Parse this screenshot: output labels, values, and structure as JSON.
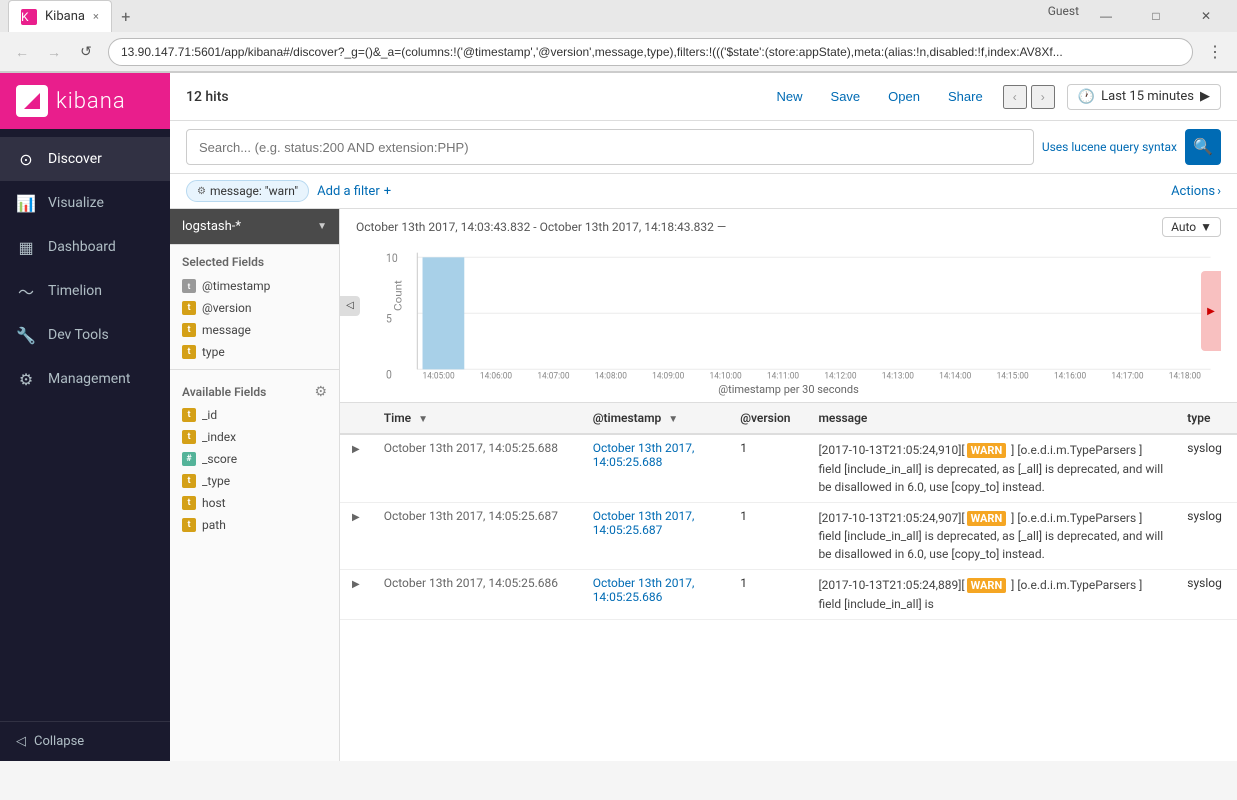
{
  "browser": {
    "title": "Kibana",
    "url": "13.90.147.71:5601/app/kibana#/discover?_g=()&_a=(columns:!('@timestamp','@version',message,type),filters:!((('$state':(store:appState),meta:(alias:!n,disabled:!f,index:AV8Xf...",
    "guest_label": "Guest",
    "tab_close": "×",
    "nav_back": "←",
    "nav_forward": "→",
    "nav_reload": "↺",
    "menu_icon": "⋮"
  },
  "sidebar": {
    "logo_text": "kibana",
    "items": [
      {
        "label": "Discover",
        "active": true
      },
      {
        "label": "Visualize",
        "active": false
      },
      {
        "label": "Dashboard",
        "active": false
      },
      {
        "label": "Timelion",
        "active": false
      },
      {
        "label": "Dev Tools",
        "active": false
      },
      {
        "label": "Management",
        "active": false
      }
    ],
    "collapse_label": "Collapse"
  },
  "topbar": {
    "hits": "12 hits",
    "new_label": "New",
    "save_label": "Save",
    "open_label": "Open",
    "share_label": "Share",
    "time_label": "Last 15 minutes"
  },
  "searchbar": {
    "placeholder": "Search... (e.g. status:200 AND extension:PHP)",
    "lucene_hint": "Uses lucene query syntax",
    "search_icon": "🔍"
  },
  "filterbar": {
    "filter_label": "message: \"warn\"",
    "add_filter_label": "Add a filter",
    "add_icon": "+",
    "actions_label": "Actions",
    "actions_icon": "›"
  },
  "leftpanel": {
    "index_pattern": "logstash-*",
    "selected_fields_label": "Selected Fields",
    "selected_fields": [
      {
        "name": "@timestamp",
        "type": "at"
      },
      {
        "name": "@version",
        "type": "t"
      },
      {
        "name": "message",
        "type": "t"
      },
      {
        "name": "type",
        "type": "t"
      }
    ],
    "available_fields_label": "Available Fields",
    "available_fields": [
      {
        "name": "_id",
        "type": "t"
      },
      {
        "name": "_index",
        "type": "t"
      },
      {
        "name": "_score",
        "type": "hash"
      },
      {
        "name": "_type",
        "type": "t"
      },
      {
        "name": "host",
        "type": "t"
      },
      {
        "name": "path",
        "type": "t"
      }
    ]
  },
  "chart": {
    "date_range": "October 13th 2017, 14:03:43.832 - October 13th 2017, 14:18:43.832 —",
    "auto_label": "Auto",
    "timestamp_label": "@timestamp per 30 seconds",
    "x_labels": [
      "14:05:00",
      "14:06:00",
      "14:07:00",
      "14:08:00",
      "14:09:00",
      "14:10:00",
      "14:11:00",
      "14:12:00",
      "14:13:00",
      "14:14:00",
      "14:15:00",
      "14:16:00",
      "14:17:00",
      "14:18:00"
    ],
    "y_labels": [
      "0",
      "5",
      "10"
    ],
    "bar_height_pct": 85,
    "y_label": "Count"
  },
  "table": {
    "columns": [
      {
        "label": "",
        "key": "expand"
      },
      {
        "label": "",
        "key": "arrow"
      },
      {
        "label": "Time",
        "key": "time",
        "sort": true
      },
      {
        "label": "@timestamp",
        "key": "timestamp",
        "sort": true
      },
      {
        "label": "@version",
        "key": "version"
      },
      {
        "label": "message",
        "key": "message"
      },
      {
        "label": "type",
        "key": "type"
      }
    ],
    "rows": [
      {
        "time": "October 13th 2017, 14:05:25.688",
        "timestamp": "October 13th 2017, 14:05:25.688",
        "version": "1",
        "message_pre": "[2017-10-13T21:05:24,910][",
        "warn_badge": "WARN",
        "message_post": " ] [o.e.d.i.m.TypeParsers    ] field [include_in_all] is deprecated, as [_all] is deprecated, and will be disallowed in 6.0, use [copy_to] instead.",
        "type": "syslog"
      },
      {
        "time": "October 13th 2017, 14:05:25.687",
        "timestamp": "October 13th 2017, 14:05:25.687",
        "version": "1",
        "message_pre": "[2017-10-13T21:05:24,907][",
        "warn_badge": "WARN",
        "message_post": " ] [o.e.d.i.m.TypeParsers    ] field [include_in_all] is deprecated, as [_all] is deprecated, and will be disallowed in 6.0, use [copy_to] instead.",
        "type": "syslog"
      },
      {
        "time": "October 13th 2017, 14:05:25.686",
        "timestamp": "October 13th 2017, 14:05:25.686",
        "version": "1",
        "message_pre": "[2017-10-13T21:05:24,889][",
        "warn_badge": "WARN",
        "message_post": " ] [o.e.d.i.m.TypeParsers    ] field [include_in_all] is",
        "type": "syslog"
      }
    ]
  }
}
